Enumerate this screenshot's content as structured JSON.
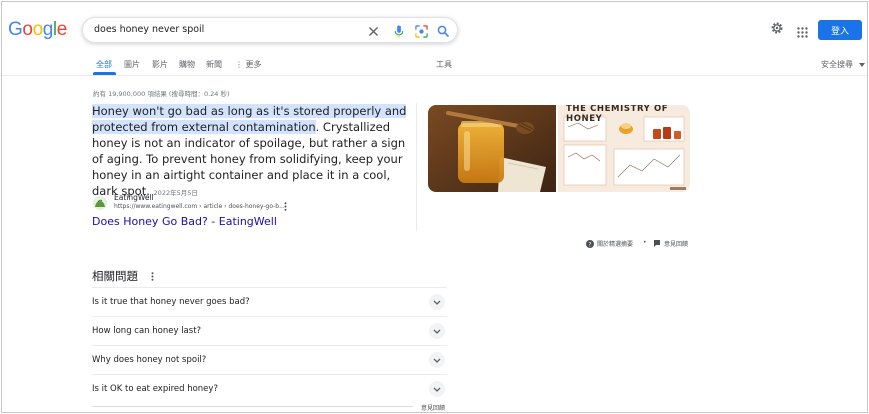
{
  "brand": {
    "logo_letters": [
      "G",
      "o",
      "o",
      "g",
      "l",
      "e"
    ],
    "logo_colors": [
      "#4285f4",
      "#ea4335",
      "#fbbc05",
      "#4285f4",
      "#34a853",
      "#ea4335"
    ],
    "accent": "#1a73e8",
    "link_color": "#1a0dab"
  },
  "search": {
    "query": "does honey never spoil"
  },
  "header": {
    "login_label": "登入"
  },
  "tabs": {
    "all": "全部",
    "images": "圖片",
    "videos": "影片",
    "shopping": "購物",
    "news": "新聞",
    "more": "⋮ 更多",
    "tools": "工具",
    "safe_search": "安全搜尋"
  },
  "result_stats": "約有 19,900,000 項結果 (搜尋時間：0.24 秒)",
  "featured_snippet": {
    "highlighted": "Honey won't go bad as long as it's stored properly and protected from external contamination",
    "rest": ". Crystallized honey is not an indicator of spoilage, but rather a sign of aging. To prevent honey from solidifying, keep your honey in an airtight container and place it in a cool, dark spot.",
    "date": "2022年5月5日",
    "source_name": "EatingWell",
    "source_url": "https://www.eatingwell.com › article › does-honey-go-b...",
    "title": "Does Honey Go Bad? - EatingWell",
    "image2_title": "THE CHEMISTRY OF HONEY",
    "about_label": "關於精選摘要",
    "feedback_label": "意見回饋"
  },
  "related": {
    "title": "相關問題",
    "questions": [
      "Is it true that honey never goes bad?",
      "How long can honey last?",
      "Why does honey not spoil?",
      "Is it OK to eat expired honey?"
    ],
    "feedback_label": "意見回饋"
  }
}
